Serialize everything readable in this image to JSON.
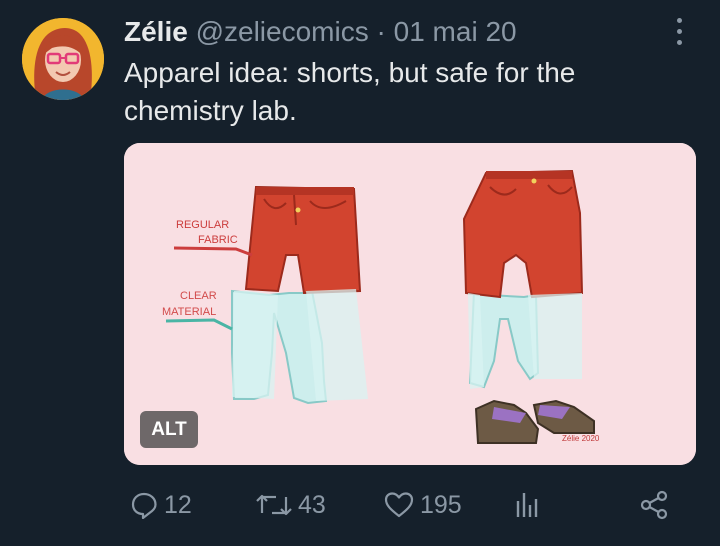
{
  "tweet": {
    "display_name": "Zélie",
    "handle": "@zeliecomics",
    "separator": "·",
    "date": "01 mai 20",
    "text": "Apparel idea: shorts, but safe for the chemistry lab."
  },
  "media": {
    "alt_label": "ALT",
    "annotations": {
      "regular_line1": "REGULAR",
      "regular_line2": "FABRIC",
      "clear_line1": "CLEAR",
      "clear_line2": "MATERIAL"
    },
    "signature": "Zélie 2020"
  },
  "actions": {
    "replies": "12",
    "reposts": "43",
    "likes": "195"
  },
  "icons": {
    "avatar": "avatar",
    "more": "more-icon",
    "reply": "reply-icon",
    "repost": "repost-icon",
    "like": "heart-icon",
    "views": "views-icon",
    "share": "share-icon"
  },
  "colors": {
    "background": "#15202b",
    "text": "#e7e9ea",
    "secondary_text": "#8b98a5",
    "image_background": "#f9dfe3",
    "shorts_red": "#d2442f",
    "clear_material": "#cdeeed"
  }
}
